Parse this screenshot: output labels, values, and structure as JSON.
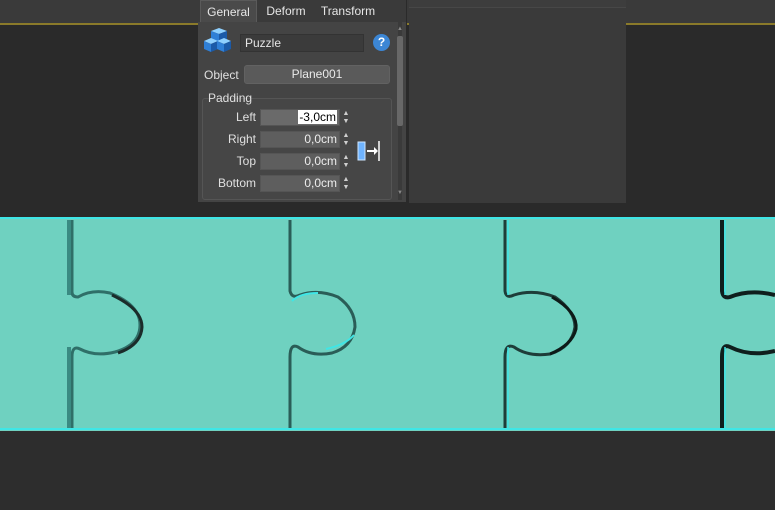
{
  "tabs": [
    {
      "label": "General",
      "active": true
    },
    {
      "label": "Deform",
      "active": false
    },
    {
      "label": "Transform",
      "active": false
    }
  ],
  "modifier": {
    "name": "Puzzle",
    "icon": "blue-cubes-icon",
    "help_icon": "help-icon",
    "help_label": "?"
  },
  "object": {
    "label": "Object",
    "value": "Plane001"
  },
  "padding": {
    "group_label": "Padding",
    "rows": [
      {
        "label": "Left",
        "value": "-3,0cm",
        "active": true
      },
      {
        "label": "Right",
        "value": "0,0cm",
        "active": false
      },
      {
        "label": "Top",
        "value": "0,0cm",
        "active": false
      },
      {
        "label": "Bottom",
        "value": "0,0cm",
        "active": false
      }
    ],
    "align_icon": "pad-right-align-icon"
  },
  "colors": {
    "puzzle_fill": "#6fd1c0",
    "puzzle_edge": "#3fe6e6",
    "panel_bg": "#444444",
    "help_blue": "#3c86d4",
    "viewport_line": "#8a7a2a"
  }
}
